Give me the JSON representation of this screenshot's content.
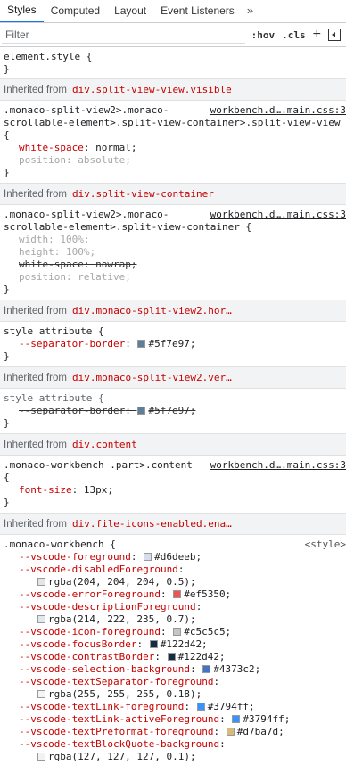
{
  "tabs": [
    "Styles",
    "Computed",
    "Layout",
    "Event Listeners"
  ],
  "more": "»",
  "filter": {
    "placeholder": "Filter",
    "hov": ":hov",
    "cls": ".cls",
    "plus": "+"
  },
  "element_style": {
    "selector": "element.style {",
    "close": "}"
  },
  "sections": [
    {
      "inherited": "Inherited from",
      "el": "div.split-view-view.visible"
    },
    {
      "selector1": ".monaco-split-view2>.monaco-",
      "selector2": "scrollable-element>.split-view-container>.split-view-view",
      "selector3": "{",
      "src": "workbench.d….main.css:3",
      "decls": [
        [
          "white-space",
          "normal;",
          ""
        ],
        [
          "position",
          "absolute;",
          "dim"
        ]
      ]
    },
    {
      "inherited": "Inherited from",
      "el": "div.split-view-container"
    },
    {
      "selector1": ".monaco-split-view2>.monaco-",
      "selector2": "scrollable-element>.split-view-container {",
      "src": "workbench.d….main.css:3",
      "decls": [
        [
          "width",
          "100%;",
          "dim"
        ],
        [
          "height",
          "100%;",
          "dim"
        ],
        [
          "white-space",
          "nowrap;",
          "dim struck"
        ],
        [
          "position",
          "relative;",
          "dim"
        ]
      ]
    },
    {
      "inherited": "Inherited from",
      "el": "div.monaco-split-view2.hor…"
    },
    {
      "selector1": "style attribute {",
      "var": [
        "--separator-border",
        "#5f7e97;",
        "#5f7e97"
      ]
    },
    {
      "inherited": "Inherited from",
      "el": "div.monaco-split-view2.ver…"
    },
    {
      "selector1": "style attribute {",
      "var_struck": [
        "--separator-border",
        "#5f7e97;",
        "#5f7e97"
      ]
    },
    {
      "inherited": "Inherited from",
      "el": "div.content"
    },
    {
      "selector1": ".monaco-workbench .part>.content",
      "selector2": "{",
      "src": "workbench.d….main.css:3",
      "decls": [
        [
          "font-size",
          "13px;",
          ""
        ]
      ]
    },
    {
      "inherited": "Inherited from",
      "el": "div.file-icons-enabled.ena…"
    }
  ],
  "workbench": {
    "selector": ".monaco-workbench {",
    "src": "<style>",
    "vars": [
      {
        "name": "--vscode-foreground",
        "val": "#d6deeb;",
        "color": "#d6deeb"
      },
      {
        "name": "--vscode-disabledForeground",
        "val": "rgba(204, 204, 204, 0.5);",
        "color": "#e5e5e5",
        "wrap": true
      },
      {
        "name": "--vscode-errorForeground",
        "val": "#ef5350;",
        "color": "#ef5350"
      },
      {
        "name": "--vscode-descriptionForeground",
        "val": "rgba(214, 222, 235, 0.7);",
        "color": "#e2e8f0",
        "wrap": true
      },
      {
        "name": "--vscode-icon-foreground",
        "val": "#c5c5c5;",
        "color": "#c5c5c5"
      },
      {
        "name": "--vscode-focusBorder",
        "val": "#122d42;",
        "color": "#122d42"
      },
      {
        "name": "--vscode-contrastBorder",
        "val": "#122d42;",
        "color": "#122d42"
      },
      {
        "name": "--vscode-selection-background",
        "val": "#4373c2;",
        "color": "#4373c2"
      },
      {
        "name": "--vscode-textSeparator-foreground",
        "val": "rgba(255, 255, 255, 0.18);",
        "color": "#f4f4f4",
        "wrap": true
      },
      {
        "name": "--vscode-textLink-foreground",
        "val": "#3794ff;",
        "color": "#3794ff"
      },
      {
        "name": "--vscode-textLink-activeForeground",
        "val": "#3794ff;",
        "color": "#3794ff"
      },
      {
        "name": "--vscode-textPreformat-foreground",
        "val": "#d7ba7d;",
        "color": "#d7ba7d"
      },
      {
        "name": "--vscode-textBlockQuote-background",
        "val": "rgba(127, 127, 127, 0.1);",
        "color": "#f2f2f2",
        "wrap": true
      }
    ]
  }
}
